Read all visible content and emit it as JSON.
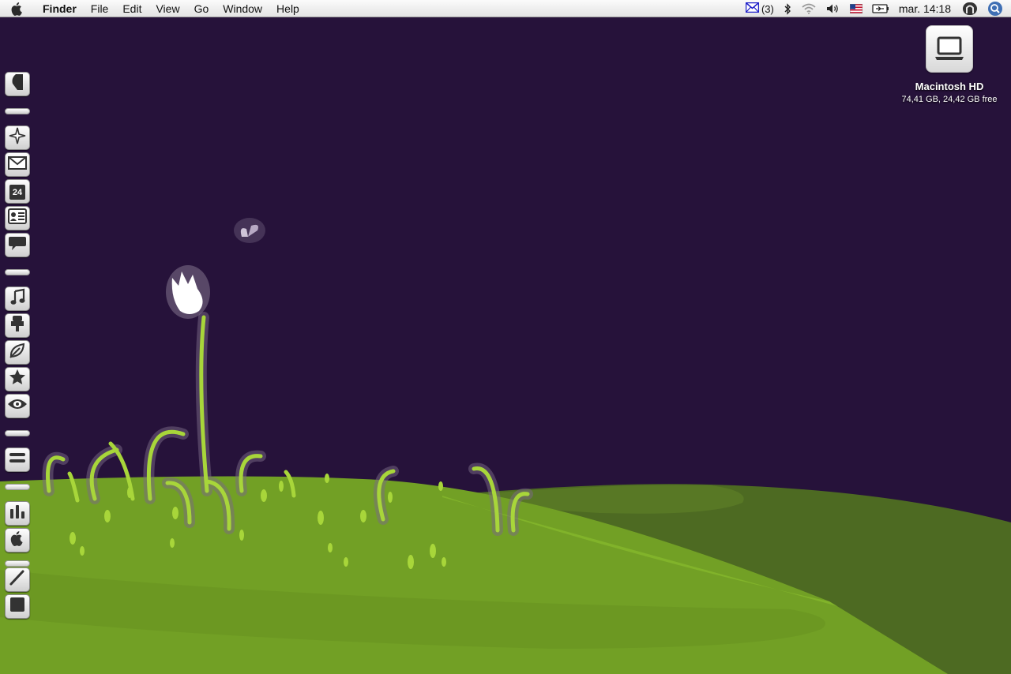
{
  "menubar": {
    "app_name": "Finder",
    "menus": [
      "File",
      "Edit",
      "View",
      "Go",
      "Window",
      "Help"
    ],
    "status": {
      "mail_count": "(3)",
      "clock": "mar. 14:18",
      "icons": [
        "mail-icon",
        "bluetooth-icon",
        "wifi-icon",
        "volume-icon",
        "us-flag-icon",
        "battery-icon",
        "user-icon",
        "spotlight-icon"
      ]
    }
  },
  "desktop": {
    "hd_icon": {
      "name": "Macintosh HD",
      "detail": "74,41 GB, 24,42 GB free"
    }
  },
  "dock": {
    "calendar_day": "24",
    "items": [
      "finder",
      "safari",
      "mail",
      "ical",
      "address-book",
      "ichat",
      "itunes",
      "iphoto",
      "utilities",
      "favorites",
      "preview",
      "list",
      "activity-monitor",
      "apple",
      "textedit",
      "stop"
    ]
  },
  "colors": {
    "background": "#26123a",
    "grass_light": "#74a222",
    "grass_dark": "#4d6a22",
    "plant": "#a8d63a"
  }
}
